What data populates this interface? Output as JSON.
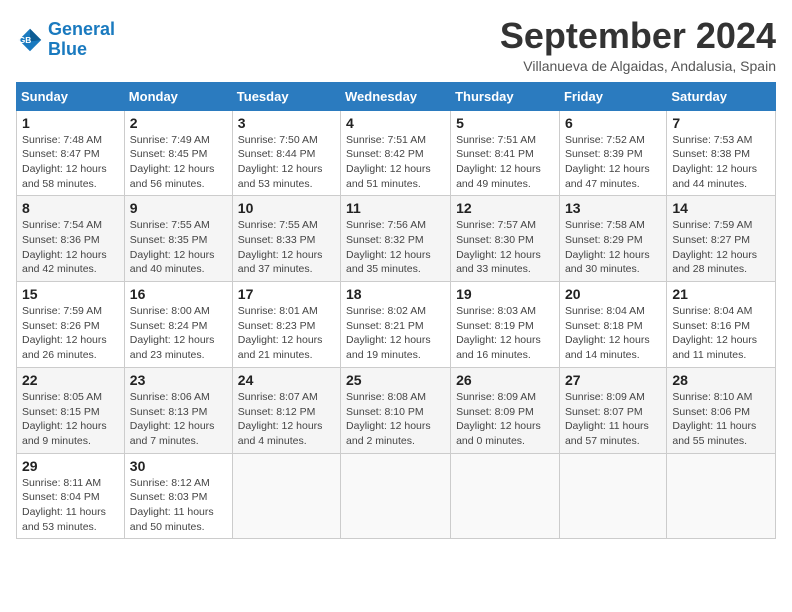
{
  "logo": {
    "line1": "General",
    "line2": "Blue"
  },
  "title": "September 2024",
  "subtitle": "Villanueva de Algaidas, Andalusia, Spain",
  "days_header": [
    "Sunday",
    "Monday",
    "Tuesday",
    "Wednesday",
    "Thursday",
    "Friday",
    "Saturday"
  ],
  "weeks": [
    [
      {
        "day": "1",
        "info": "Sunrise: 7:48 AM\nSunset: 8:47 PM\nDaylight: 12 hours\nand 58 minutes."
      },
      {
        "day": "2",
        "info": "Sunrise: 7:49 AM\nSunset: 8:45 PM\nDaylight: 12 hours\nand 56 minutes."
      },
      {
        "day": "3",
        "info": "Sunrise: 7:50 AM\nSunset: 8:44 PM\nDaylight: 12 hours\nand 53 minutes."
      },
      {
        "day": "4",
        "info": "Sunrise: 7:51 AM\nSunset: 8:42 PM\nDaylight: 12 hours\nand 51 minutes."
      },
      {
        "day": "5",
        "info": "Sunrise: 7:51 AM\nSunset: 8:41 PM\nDaylight: 12 hours\nand 49 minutes."
      },
      {
        "day": "6",
        "info": "Sunrise: 7:52 AM\nSunset: 8:39 PM\nDaylight: 12 hours\nand 47 minutes."
      },
      {
        "day": "7",
        "info": "Sunrise: 7:53 AM\nSunset: 8:38 PM\nDaylight: 12 hours\nand 44 minutes."
      }
    ],
    [
      {
        "day": "8",
        "info": "Sunrise: 7:54 AM\nSunset: 8:36 PM\nDaylight: 12 hours\nand 42 minutes."
      },
      {
        "day": "9",
        "info": "Sunrise: 7:55 AM\nSunset: 8:35 PM\nDaylight: 12 hours\nand 40 minutes."
      },
      {
        "day": "10",
        "info": "Sunrise: 7:55 AM\nSunset: 8:33 PM\nDaylight: 12 hours\nand 37 minutes."
      },
      {
        "day": "11",
        "info": "Sunrise: 7:56 AM\nSunset: 8:32 PM\nDaylight: 12 hours\nand 35 minutes."
      },
      {
        "day": "12",
        "info": "Sunrise: 7:57 AM\nSunset: 8:30 PM\nDaylight: 12 hours\nand 33 minutes."
      },
      {
        "day": "13",
        "info": "Sunrise: 7:58 AM\nSunset: 8:29 PM\nDaylight: 12 hours\nand 30 minutes."
      },
      {
        "day": "14",
        "info": "Sunrise: 7:59 AM\nSunset: 8:27 PM\nDaylight: 12 hours\nand 28 minutes."
      }
    ],
    [
      {
        "day": "15",
        "info": "Sunrise: 7:59 AM\nSunset: 8:26 PM\nDaylight: 12 hours\nand 26 minutes."
      },
      {
        "day": "16",
        "info": "Sunrise: 8:00 AM\nSunset: 8:24 PM\nDaylight: 12 hours\nand 23 minutes."
      },
      {
        "day": "17",
        "info": "Sunrise: 8:01 AM\nSunset: 8:23 PM\nDaylight: 12 hours\nand 21 minutes."
      },
      {
        "day": "18",
        "info": "Sunrise: 8:02 AM\nSunset: 8:21 PM\nDaylight: 12 hours\nand 19 minutes."
      },
      {
        "day": "19",
        "info": "Sunrise: 8:03 AM\nSunset: 8:19 PM\nDaylight: 12 hours\nand 16 minutes."
      },
      {
        "day": "20",
        "info": "Sunrise: 8:04 AM\nSunset: 8:18 PM\nDaylight: 12 hours\nand 14 minutes."
      },
      {
        "day": "21",
        "info": "Sunrise: 8:04 AM\nSunset: 8:16 PM\nDaylight: 12 hours\nand 11 minutes."
      }
    ],
    [
      {
        "day": "22",
        "info": "Sunrise: 8:05 AM\nSunset: 8:15 PM\nDaylight: 12 hours\nand 9 minutes."
      },
      {
        "day": "23",
        "info": "Sunrise: 8:06 AM\nSunset: 8:13 PM\nDaylight: 12 hours\nand 7 minutes."
      },
      {
        "day": "24",
        "info": "Sunrise: 8:07 AM\nSunset: 8:12 PM\nDaylight: 12 hours\nand 4 minutes."
      },
      {
        "day": "25",
        "info": "Sunrise: 8:08 AM\nSunset: 8:10 PM\nDaylight: 12 hours\nand 2 minutes."
      },
      {
        "day": "26",
        "info": "Sunrise: 8:09 AM\nSunset: 8:09 PM\nDaylight: 12 hours\nand 0 minutes."
      },
      {
        "day": "27",
        "info": "Sunrise: 8:09 AM\nSunset: 8:07 PM\nDaylight: 11 hours\nand 57 minutes."
      },
      {
        "day": "28",
        "info": "Sunrise: 8:10 AM\nSunset: 8:06 PM\nDaylight: 11 hours\nand 55 minutes."
      }
    ],
    [
      {
        "day": "29",
        "info": "Sunrise: 8:11 AM\nSunset: 8:04 PM\nDaylight: 11 hours\nand 53 minutes."
      },
      {
        "day": "30",
        "info": "Sunrise: 8:12 AM\nSunset: 8:03 PM\nDaylight: 11 hours\nand 50 minutes."
      },
      {
        "day": "",
        "info": ""
      },
      {
        "day": "",
        "info": ""
      },
      {
        "day": "",
        "info": ""
      },
      {
        "day": "",
        "info": ""
      },
      {
        "day": "",
        "info": ""
      }
    ]
  ]
}
